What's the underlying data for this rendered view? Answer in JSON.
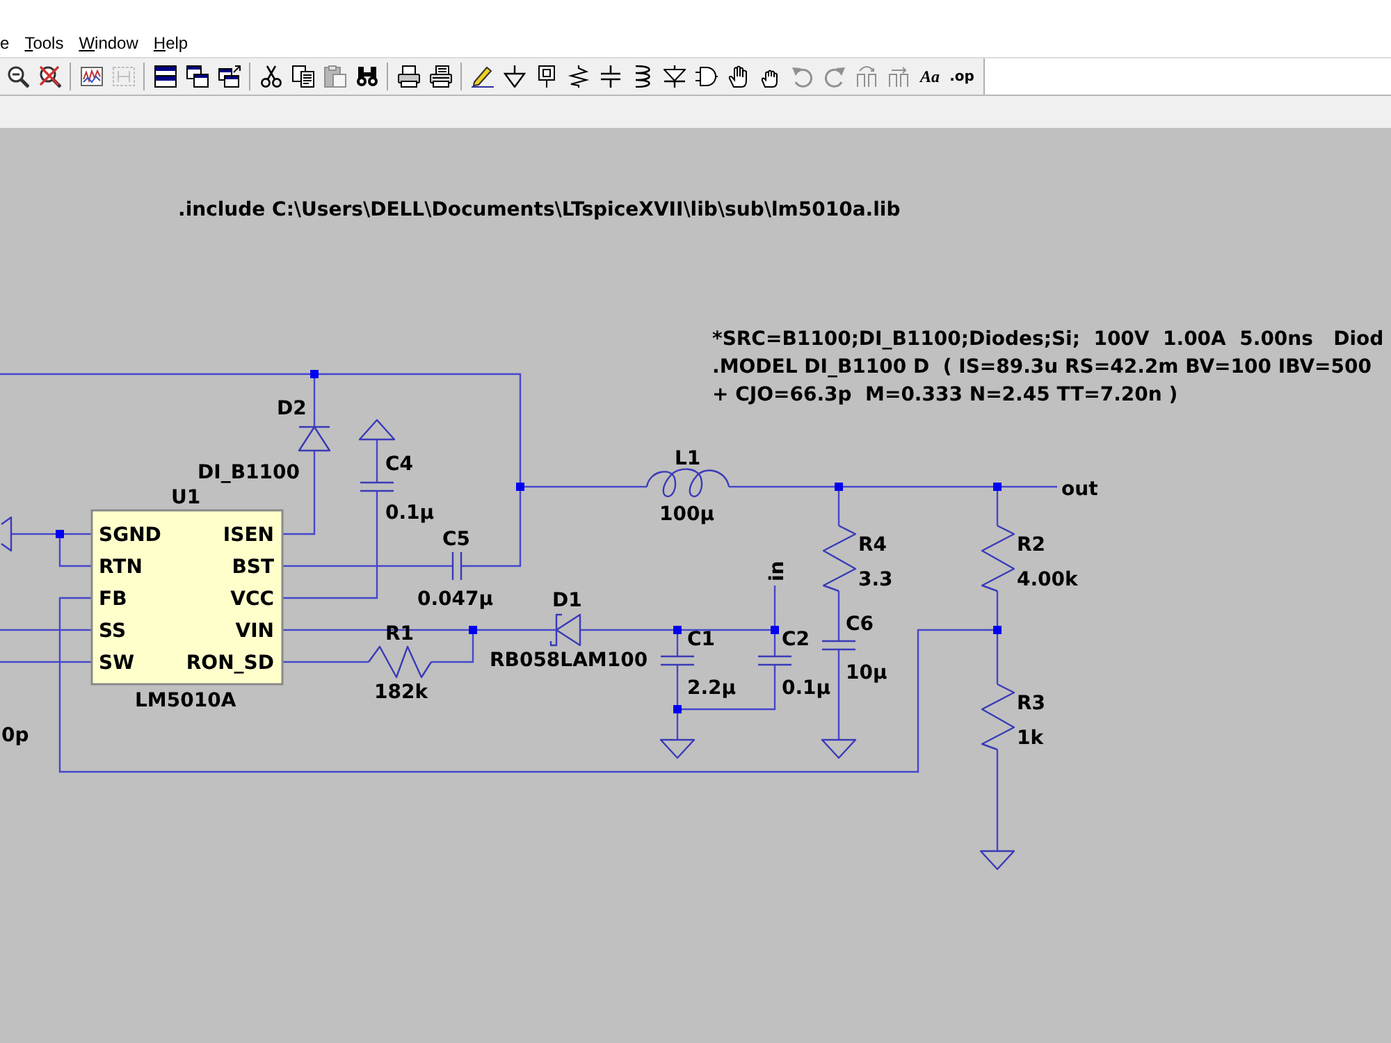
{
  "menu_bar": [
    {
      "label": "e",
      "underline_first": false
    },
    {
      "label": "Tools",
      "underline_first": true
    },
    {
      "label": "Window",
      "underline_first": true
    },
    {
      "label": "Help",
      "underline_first": true
    }
  ],
  "toolbar": [
    {
      "kind": "zoom-out",
      "disabled": false
    },
    {
      "kind": "zoom-cancel",
      "disabled": false
    },
    {
      "kind": "separator"
    },
    {
      "kind": "chart",
      "disabled": false
    },
    {
      "kind": "chart-frame",
      "disabled": true
    },
    {
      "kind": "separator"
    },
    {
      "kind": "tile",
      "disabled": false
    },
    {
      "kind": "cascade",
      "disabled": false
    },
    {
      "kind": "cascade-arrow",
      "disabled": false
    },
    {
      "kind": "separator"
    },
    {
      "kind": "cut",
      "disabled": false
    },
    {
      "kind": "copy",
      "disabled": false
    },
    {
      "kind": "paste",
      "disabled": true
    },
    {
      "kind": "find",
      "disabled": false
    },
    {
      "kind": "separator"
    },
    {
      "kind": "print-setup",
      "disabled": false
    },
    {
      "kind": "print",
      "disabled": false
    },
    {
      "kind": "separator"
    },
    {
      "kind": "pencil",
      "disabled": false
    },
    {
      "kind": "ground",
      "disabled": false
    },
    {
      "kind": "label",
      "disabled": false
    },
    {
      "kind": "resistor",
      "disabled": false
    },
    {
      "kind": "capacitor",
      "disabled": false
    },
    {
      "kind": "inductor",
      "disabled": false
    },
    {
      "kind": "diode",
      "disabled": false
    },
    {
      "kind": "component",
      "disabled": false
    },
    {
      "kind": "move",
      "disabled": false
    },
    {
      "kind": "drag",
      "disabled": false
    },
    {
      "kind": "undo",
      "disabled": true
    },
    {
      "kind": "redo",
      "disabled": true
    },
    {
      "kind": "rotate",
      "disabled": true
    },
    {
      "kind": "mirror",
      "disabled": true
    },
    {
      "kind": "font",
      "label": "Aa",
      "disabled": false
    },
    {
      "kind": "directive",
      "label": ".op",
      "disabled": false
    }
  ],
  "schematic": {
    "directive": ".include C:\\Users\\DELL\\Documents\\LTspiceXVII\\lib\\sub\\lm5010a.lib",
    "model_lines": [
      "*SRC=B1100;DI_B1100;Diodes;Si;  100V  1.00A  5.00ns   Diod",
      ".MODEL DI_B1100 D  ( IS=89.3u RS=42.2m BV=100 IBV=500",
      "+ CJO=66.3p  M=0.333 N=2.45 TT=7.20n )"
    ],
    "parts": [
      {
        "kind": "diode",
        "ref": "D2",
        "value": "DI_B1100"
      },
      {
        "kind": "capacitor",
        "ref": "C4",
        "value": "0.1µ"
      },
      {
        "kind": "inductor",
        "ref": "L1",
        "value": "100µ"
      },
      {
        "kind": "ic",
        "ref": "U1",
        "value": "LM5010A",
        "pins_left": [
          "SGND",
          "RTN",
          "FB",
          "SS",
          "SW"
        ],
        "pins_right": [
          "ISEN",
          "BST",
          "VCC",
          "VIN",
          "RON_SD"
        ]
      },
      {
        "kind": "capacitor",
        "ref": "C5",
        "value": "0.047µ"
      },
      {
        "kind": "resistor",
        "ref": "R4",
        "value": "3.3"
      },
      {
        "kind": "resistor",
        "ref": "R2",
        "value": "4.00k"
      },
      {
        "kind": "schottky",
        "ref": "D1",
        "value": "RB058LAM100"
      },
      {
        "kind": "capacitor",
        "ref": "C6",
        "value": "10µ"
      },
      {
        "kind": "resistor",
        "ref": "R1",
        "value": "182k"
      },
      {
        "kind": "capacitor",
        "ref": "C1",
        "value": "2.2µ"
      },
      {
        "kind": "capacitor",
        "ref": "C2",
        "value": "0.1µ"
      },
      {
        "kind": "resistor",
        "ref": "R3",
        "value": "1k"
      }
    ],
    "net_labels": [
      "out",
      "in"
    ],
    "edge_text": "0p"
  }
}
